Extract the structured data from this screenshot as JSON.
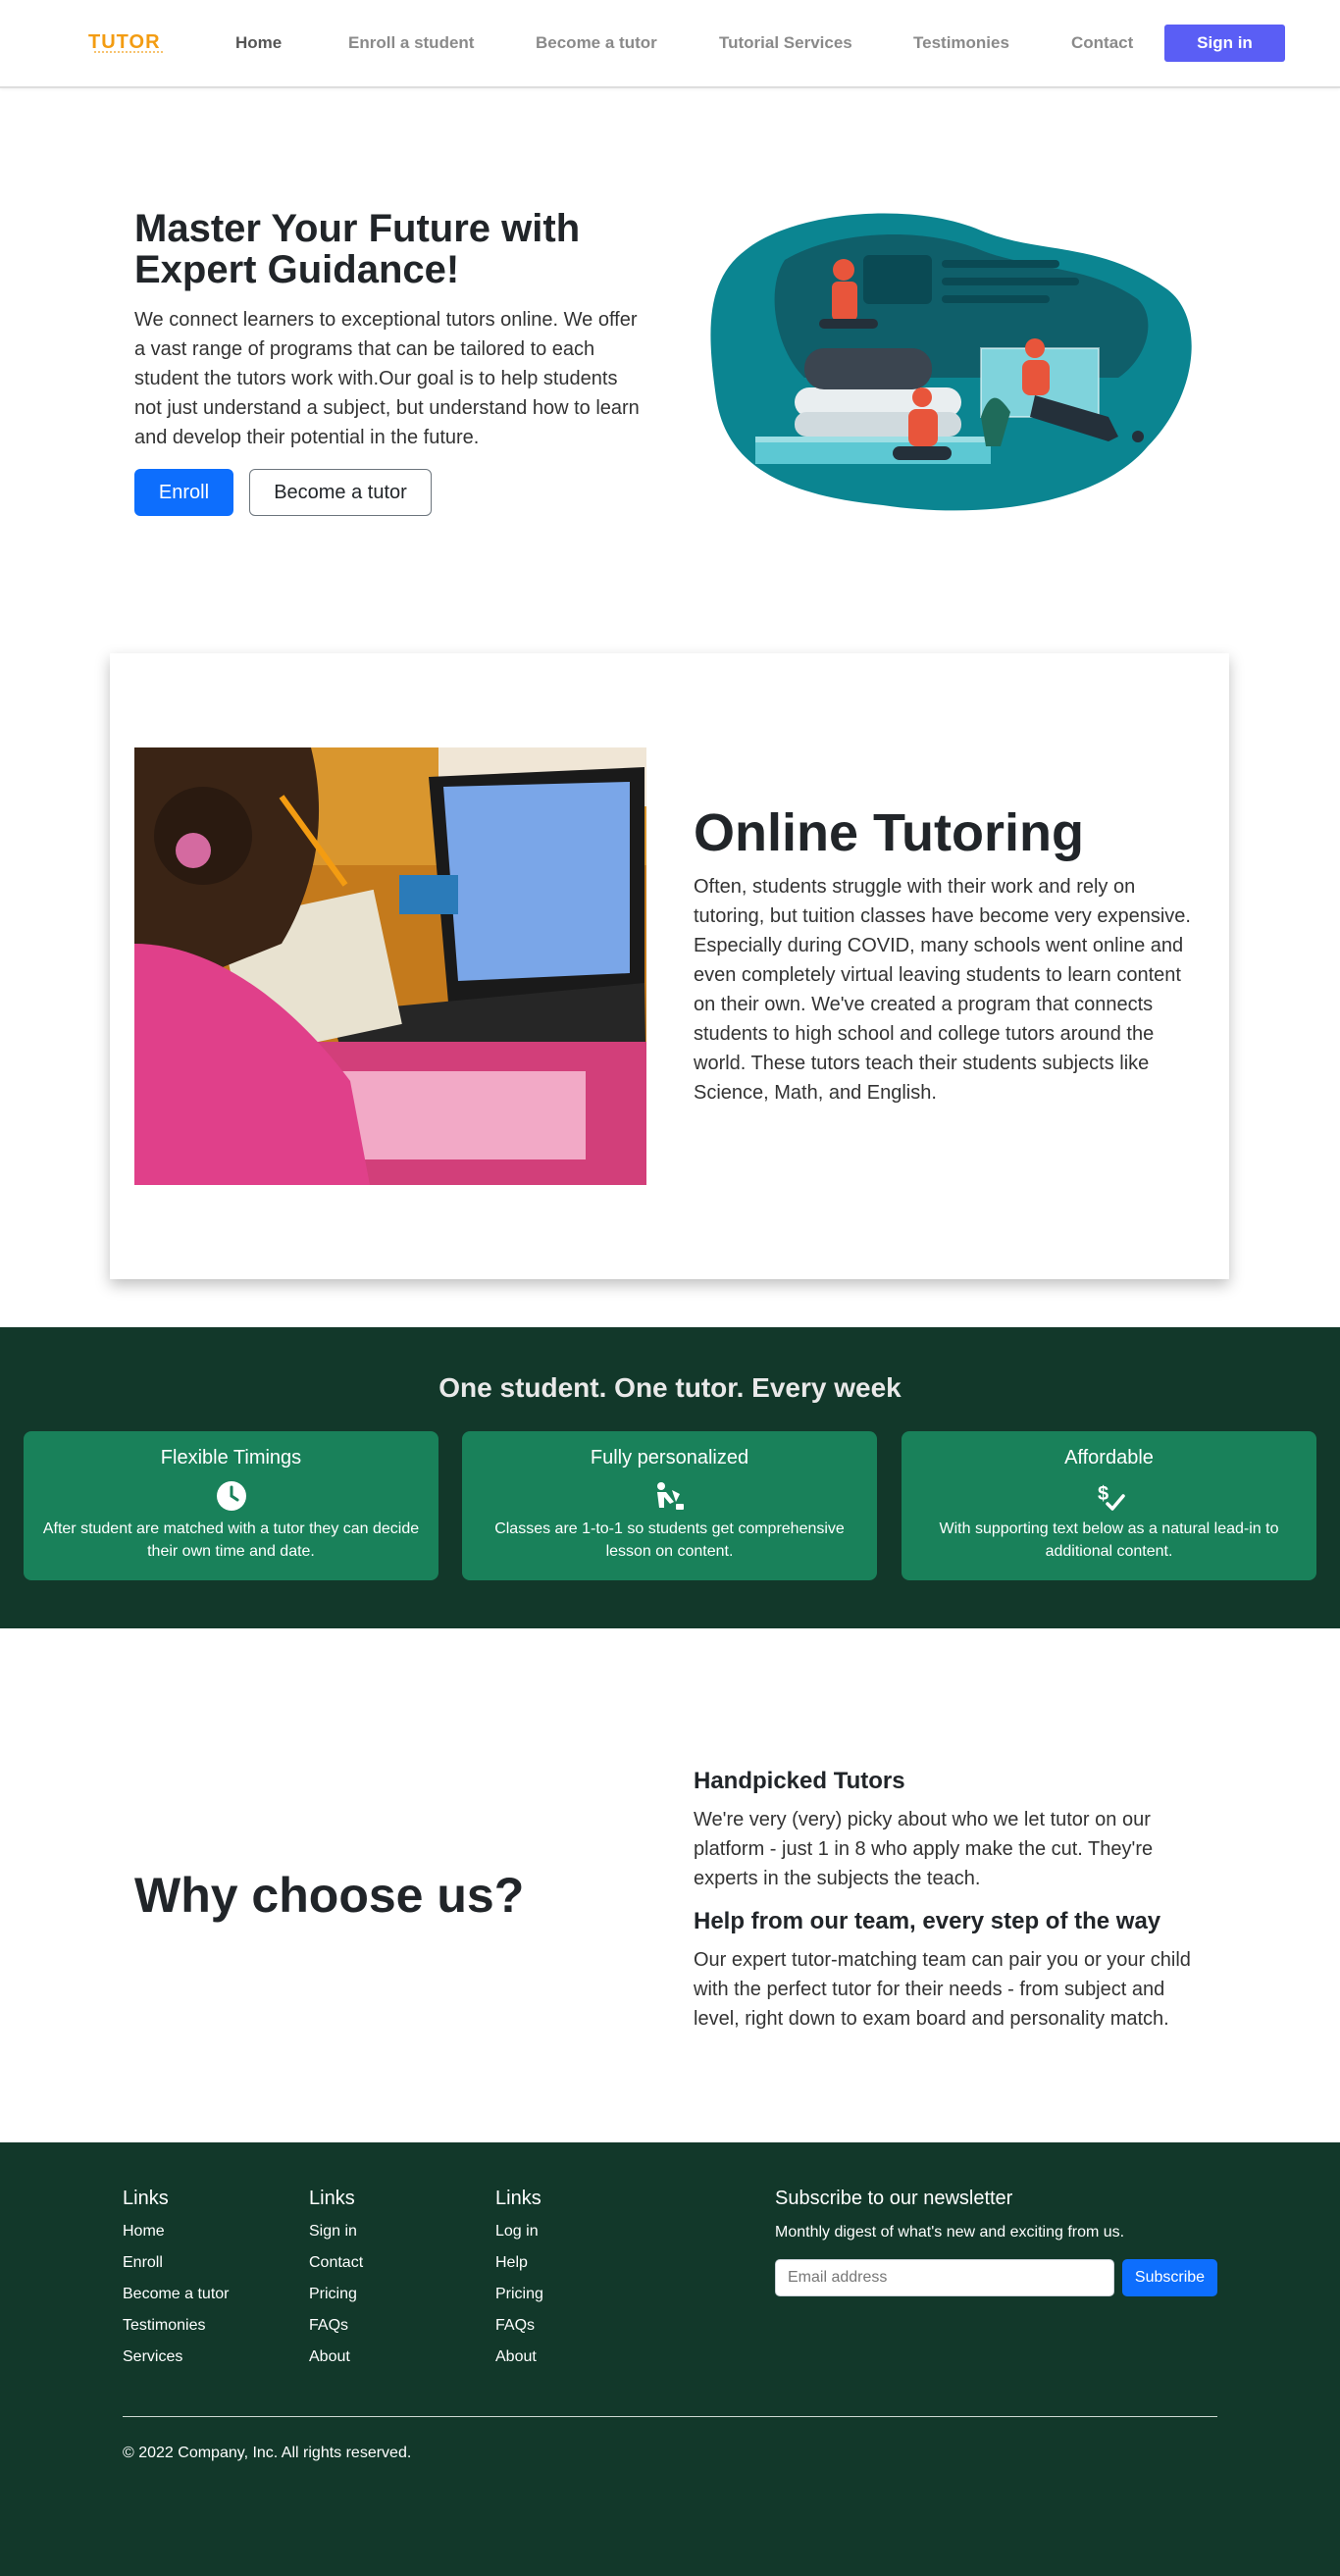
{
  "nav": {
    "logo_text": "TUTOR",
    "links": [
      "Home",
      "Enroll a student",
      "Become a tutor",
      "Tutorial Services",
      "Testimonies",
      "Contact"
    ],
    "signin": "Sign in"
  },
  "hero": {
    "title": "Master Your Future with Expert Guidance!",
    "text": "We connect learners to exceptional tutors online. We offer a vast range of programs that can be tailored to each student the tutors work with.Our goal is to help students not just understand a subject, but understand how to learn and develop their potential in the future.",
    "enroll": "Enroll",
    "become_tutor": "Become a tutor"
  },
  "online": {
    "title": "Online Tutoring",
    "text": "Often, students struggle with their work and rely on tutoring, but tuition classes have become very expensive. Especially during COVID, many schools went online and even completely virtual leaving students to learn content on their own. We've created a program that connects students to high school and college tutors around the world. These tutors teach their students subjects like Science, Math, and English."
  },
  "features": {
    "title": "One student. One tutor. Every week",
    "cards": [
      {
        "title": "Flexible Timings",
        "icon": "clock-icon",
        "text": "After student are matched with a tutor they can decide their own time and date."
      },
      {
        "title": "Fully personalized",
        "icon": "personalize-icon",
        "text": "Classes are 1-to-1 so students get comprehensive lesson on content."
      },
      {
        "title": "Affordable",
        "icon": "dollar-check-icon",
        "text": "With supporting text below as a natural lead-in to additional content."
      }
    ]
  },
  "why": {
    "title": "Why choose us?",
    "items": [
      {
        "heading": "Handpicked Tutors",
        "text": "We're very (very) picky about who we let tutor on our platform - just 1 in 8 who apply make the cut. They're experts in the subjects the teach."
      },
      {
        "heading": "Help from our team, every step of the way",
        "text": "Our expert tutor-matching team can pair you or your child with the perfect tutor for their needs - from subject and level, right down to exam board and personality match."
      }
    ]
  },
  "footer": {
    "columns": [
      {
        "title": "Links",
        "links": [
          "Home",
          "Enroll",
          "Become a tutor",
          "Testimonies",
          "Services"
        ]
      },
      {
        "title": "Links",
        "links": [
          "Sign in",
          "Contact",
          "Pricing",
          "FAQs",
          "About"
        ]
      },
      {
        "title": "Links",
        "links": [
          "Log in",
          "Help",
          "Pricing",
          "FAQs",
          "About"
        ]
      }
    ],
    "newsletter": {
      "title": "Subscribe to our newsletter",
      "subtitle": "Monthly digest of what's new and exciting from us.",
      "placeholder": "Email address",
      "button": "Subscribe"
    },
    "copyright": "© 2022 Company, Inc. All rights reserved."
  },
  "colors": {
    "primary": "#0d6efd",
    "signin": "#5a5ef5",
    "dark_green": "#12382a",
    "card_green": "#19815a",
    "logo_orange": "#f39c12"
  }
}
